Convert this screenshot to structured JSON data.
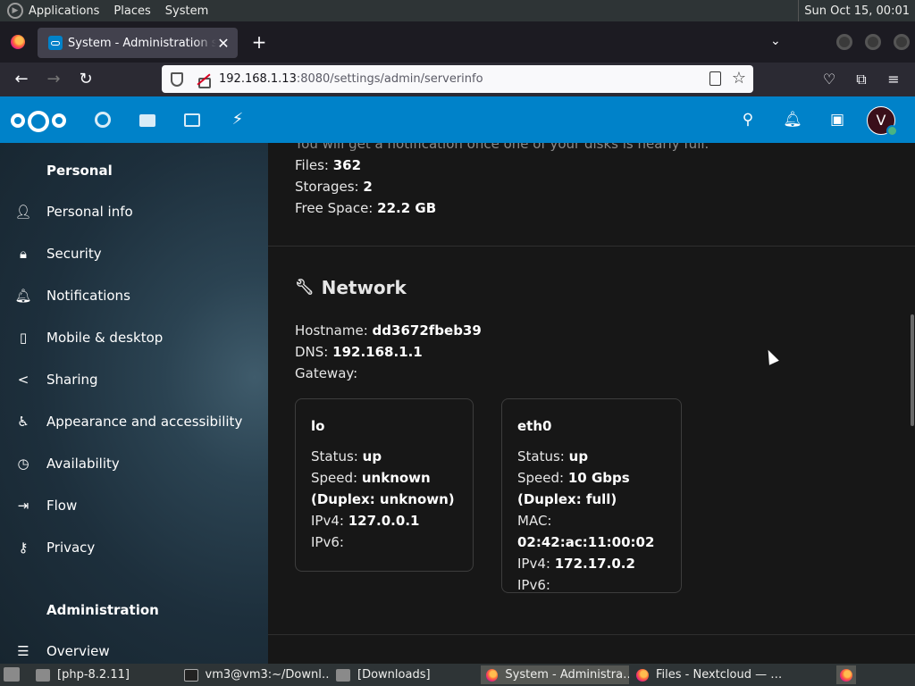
{
  "gnome_panel": {
    "menus": [
      "Applications",
      "Places",
      "System"
    ],
    "clock": "Sun Oct 15, 00:01"
  },
  "browser": {
    "tab_title": "System - Administration settings",
    "url_host": "192.168.1.13",
    "url_rest": ":8080/settings/admin/serverinfo"
  },
  "sidebar": {
    "personal_caption": "Personal",
    "items": [
      {
        "label": "Personal info",
        "icon": "user-icon"
      },
      {
        "label": "Security",
        "icon": "lock-icon"
      },
      {
        "label": "Notifications",
        "icon": "bell-icon"
      },
      {
        "label": "Mobile & desktop",
        "icon": "phone-icon"
      },
      {
        "label": "Sharing",
        "icon": "share-icon"
      },
      {
        "label": "Appearance and accessibility",
        "icon": "accessibility-icon"
      },
      {
        "label": "Availability",
        "icon": "clock-icon"
      },
      {
        "label": "Flow",
        "icon": "flow-icon"
      },
      {
        "label": "Privacy",
        "icon": "key-icon"
      }
    ],
    "admin_caption": "Administration",
    "admin_items": [
      {
        "label": "Overview",
        "icon": "list-icon"
      }
    ]
  },
  "storage": {
    "notice": "You will get a notification once one of your disks is nearly full.",
    "files_label": "Files:",
    "files_value": "362",
    "storages_label": "Storages:",
    "storages_value": "2",
    "free_label": "Free Space:",
    "free_value": "22.2 GB"
  },
  "network": {
    "title": "Network",
    "hostname_label": "Hostname:",
    "hostname_value": "dd3672fbeb39",
    "dns_label": "DNS:",
    "dns_value": "192.168.1.1",
    "gateway_label": "Gateway:",
    "interfaces": [
      {
        "name": "lo",
        "status": "up",
        "speed": "unknown (Duplex: unknown)",
        "ipv4": "127.0.0.1",
        "ipv6": ""
      },
      {
        "name": "eth0",
        "status": "up",
        "speed": "10 Gbps (Duplex: full)",
        "mac": "02:42:ac:11:00:02",
        "ipv4": "172.17.0.2",
        "ipv6": ""
      }
    ],
    "labels": {
      "status": "Status:",
      "speed": "Speed:",
      "mac": "MAC:",
      "ipv4": "IPv4:",
      "ipv6": "IPv6:"
    }
  },
  "user": {
    "avatar_initial": "V"
  },
  "taskbar": {
    "tasks": [
      "[php-8.2.11]",
      "vm3@vm3:~/Downl…",
      "[Downloads]",
      "System - Administra…",
      "Files - Nextcloud — …"
    ]
  },
  "colors": {
    "nextcloud_blue": "#0082c9",
    "online_status": "#49b382"
  }
}
